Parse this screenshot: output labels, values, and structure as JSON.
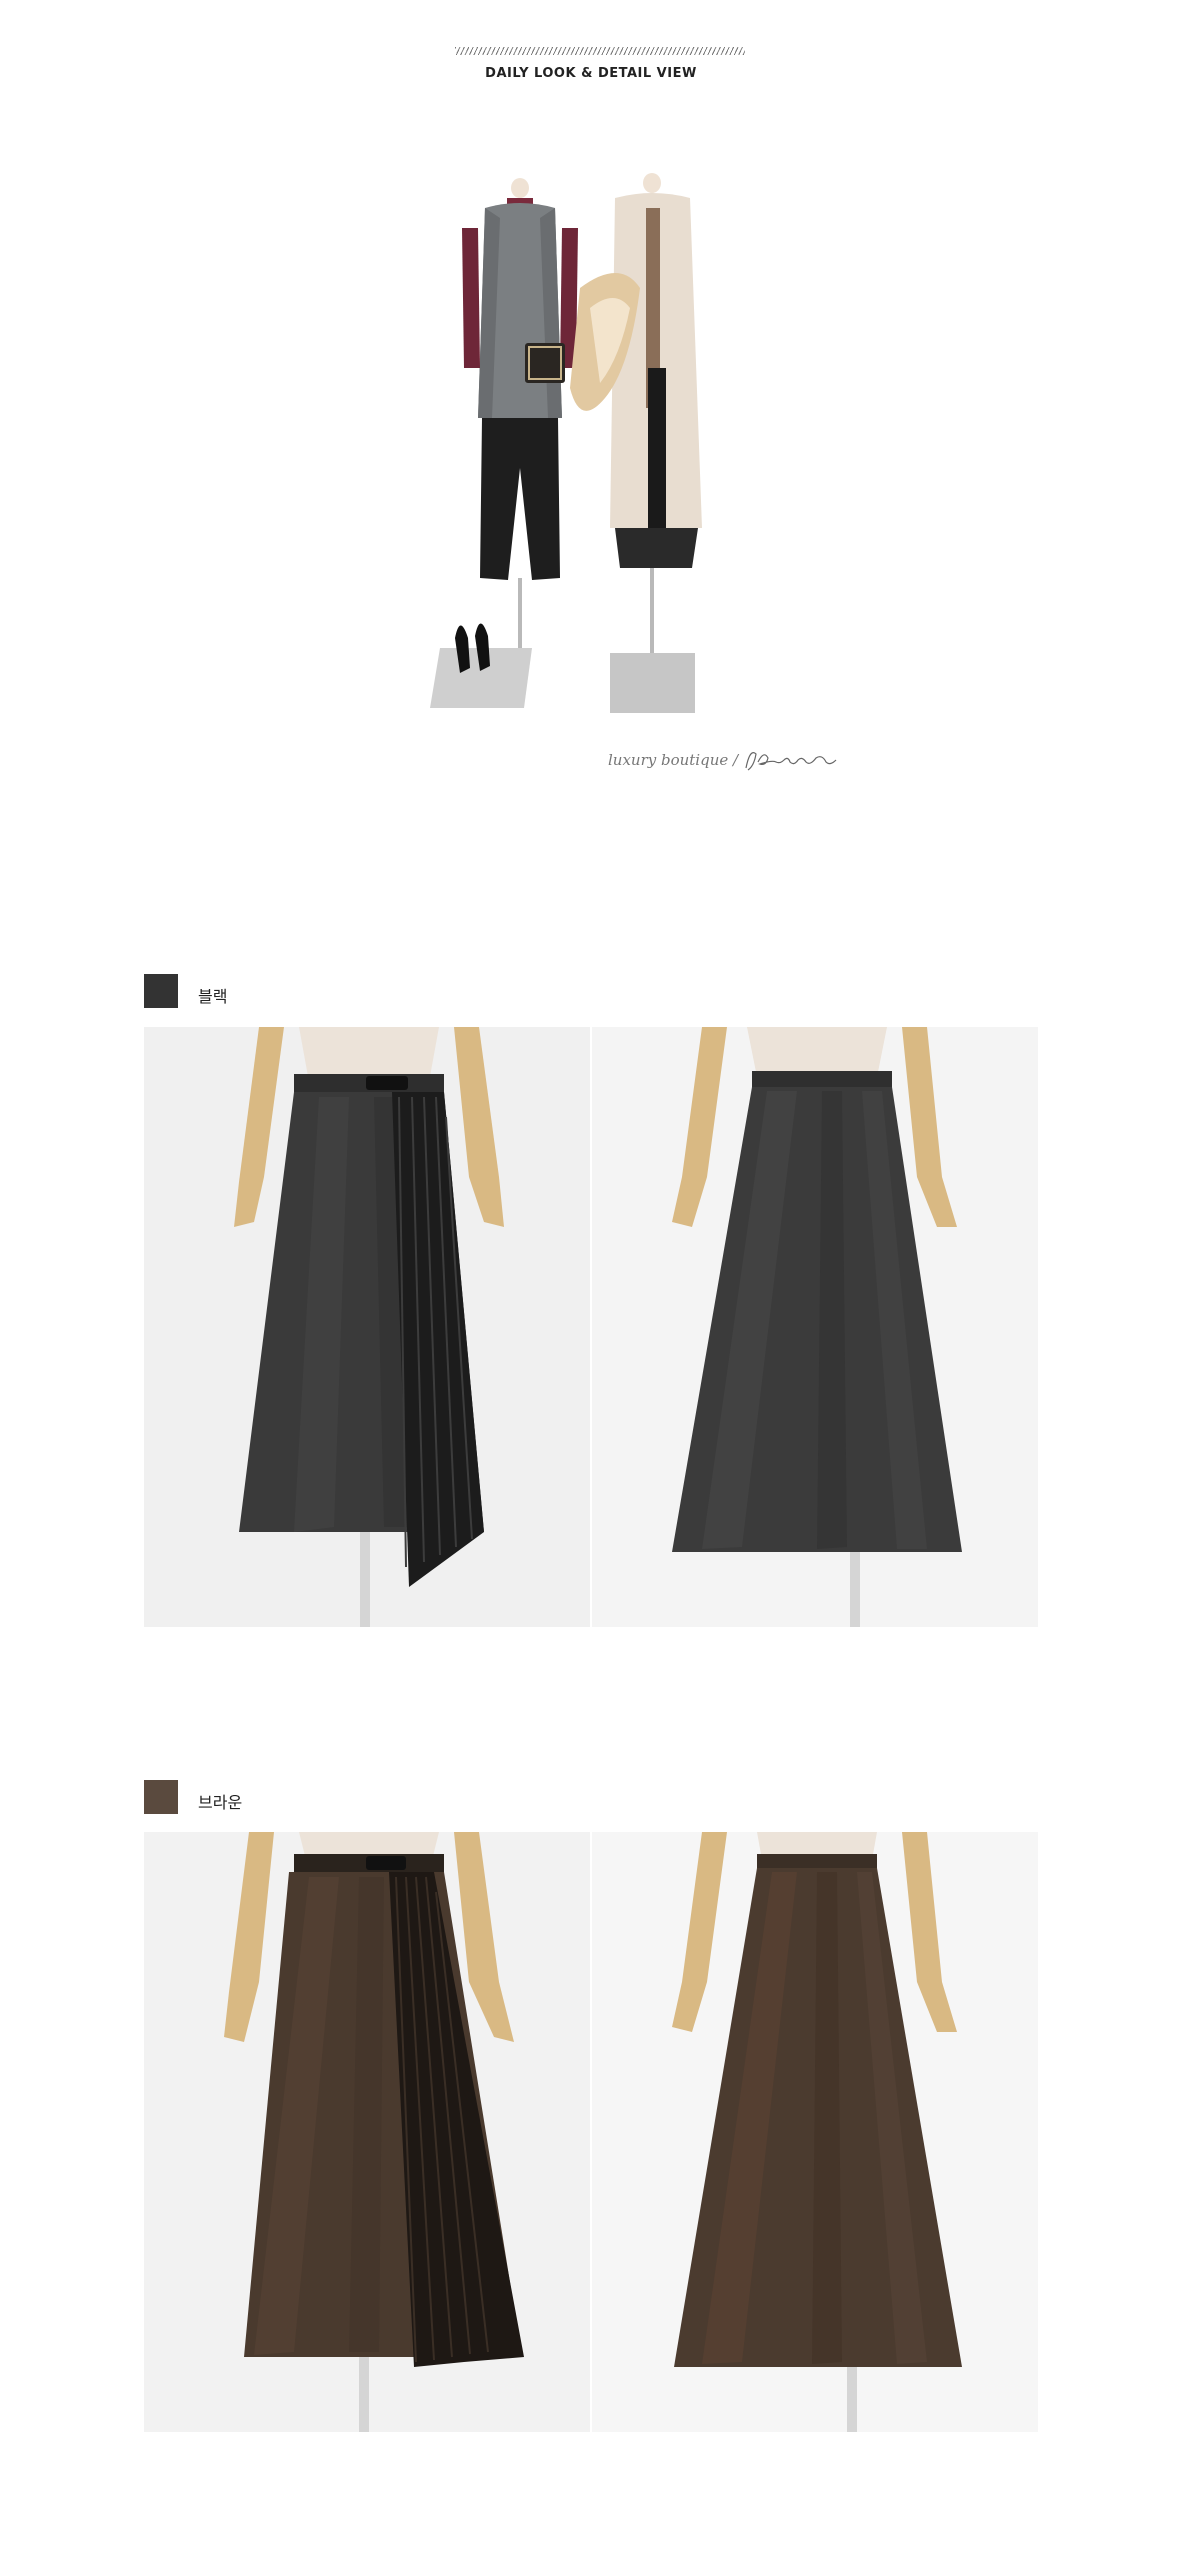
{
  "header": {
    "section_title": "DAILY LOOK & DETAIL VIEW"
  },
  "lookbook": {
    "tagline": "luxury boutique  /",
    "signature_icon": "jblanc-signature-icon"
  },
  "colors": [
    {
      "label": "블랙",
      "swatch": "#333333",
      "skirt_tone": "#3a3a3a",
      "views": [
        "front-view-photo",
        "back-view-photo"
      ]
    },
    {
      "label": "브라운",
      "swatch": "#5a4a3e",
      "skirt_tone": "#4a3a2e",
      "views": [
        "front-view-photo",
        "back-view-photo"
      ]
    }
  ]
}
